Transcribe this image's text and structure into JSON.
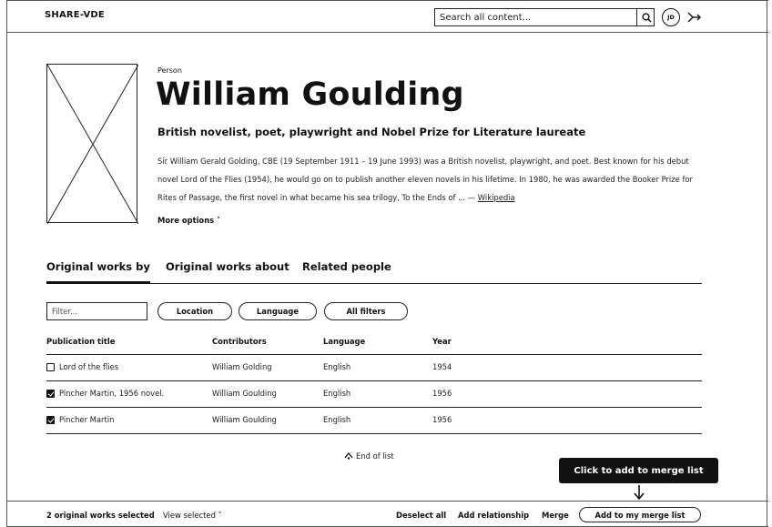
{
  "header": {
    "brand": "SHARE-VDE",
    "search_placeholder": "Search all content...",
    "avatar_initials": "JD"
  },
  "person": {
    "type": "Person",
    "name": "William Goulding",
    "tagline": "British novelist, poet, playwright and Nobel Prize for Literature laureate",
    "bio": "Sir William Gerald Golding, CBE (19 September 1911 – 19 June 1993) was a British novelist, playwright, and poet. Best known for his debut novel Lord of the Flies (1954), he would go on to publish another eleven novels in his lifetime. In 1980, he was awarded the Booker Prize for Rites of Passage, the first novel in what became his sea trilogy, To the Ends of ... — ",
    "wiki_link": "Wikipedia",
    "more_options": "More options ˅"
  },
  "tabs": [
    {
      "label": "Original works by",
      "active": true
    },
    {
      "label": "Original works about",
      "active": false
    },
    {
      "label": "Related people",
      "active": false
    }
  ],
  "filters": {
    "placeholder": "Filter...",
    "location": "Location",
    "language": "Language",
    "all_filters": "All filters"
  },
  "table": {
    "columns": [
      "Publication title",
      "Contributors",
      "Language",
      "Year"
    ],
    "rows": [
      {
        "title": "Lord of the flies",
        "contributors": "William Golding",
        "language": "English",
        "year": "1954",
        "checked": false
      },
      {
        "title": "Pincher Martin, 1956 novel.",
        "contributors": "William Goulding",
        "language": "English",
        "year": "1956",
        "checked": true
      },
      {
        "title": "Pincher Martin",
        "contributors": "William Goulding",
        "language": "English",
        "year": "1956",
        "checked": true
      }
    ],
    "end_of_list": "End of list"
  },
  "tooltip": "Click to add to merge list",
  "footer": {
    "selected_count": "2 original works selected",
    "view_selected": "View selected ˄",
    "deselect_all": "Deselect all",
    "add_relationship": "Add relationship",
    "merge": "Merge",
    "add_to_merge_list": "Add to my merge list"
  }
}
